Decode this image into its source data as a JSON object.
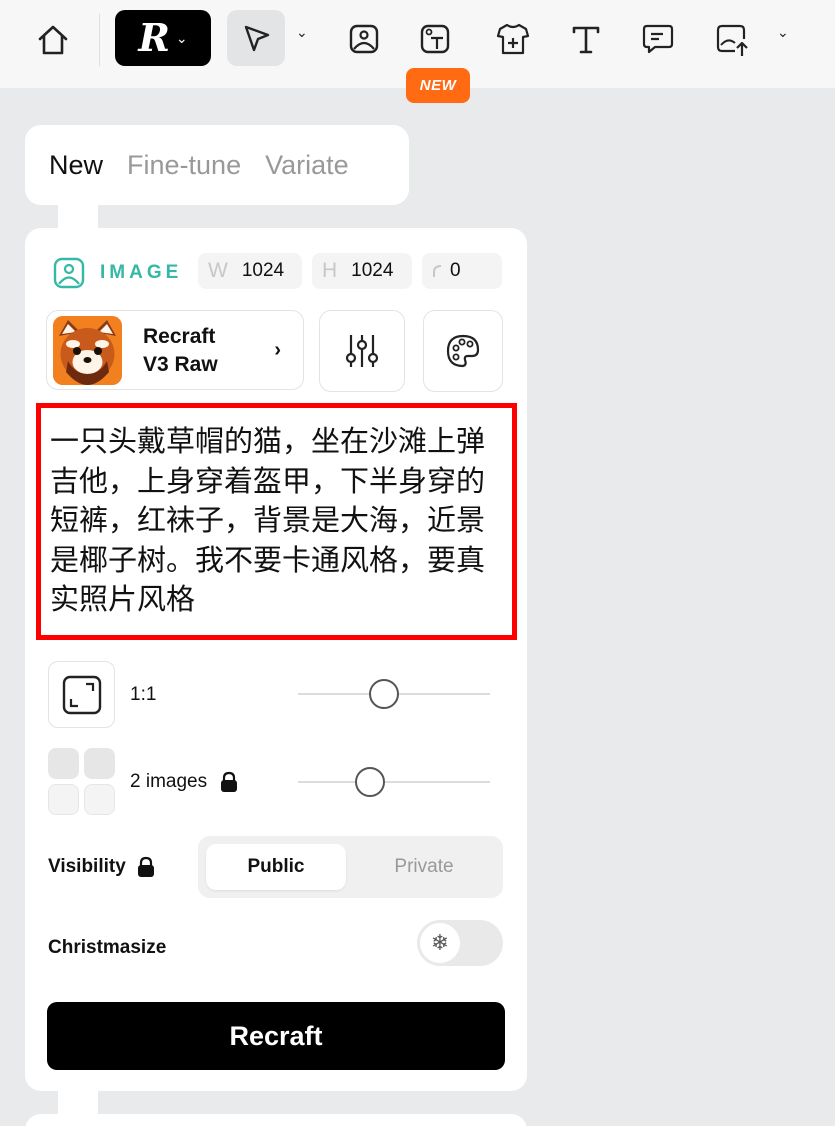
{
  "toolbar": {
    "new_badge": "NEW",
    "logo_letter": "R",
    "items": [
      "home-icon",
      "recraft-logo",
      "select-arrow-icon",
      "image-icon",
      "text-image-icon",
      "mockup-shirt-icon",
      "text-icon",
      "comment-icon",
      "upload-image-icon"
    ]
  },
  "tabs": {
    "new": "New",
    "finetune": "Fine-tune",
    "variate": "Variate"
  },
  "image_settings": {
    "label": "IMAGE",
    "width_label": "W",
    "width": "1024",
    "height_label": "H",
    "height": "1024",
    "corner": "0"
  },
  "model": {
    "line1": "Recraft",
    "line2": "V3 Raw"
  },
  "prompt": {
    "text": "一只头戴草帽的猫，坐在沙滩上弹吉他，上身穿着盔甲，下半身穿的短裤，红袜子，背景是大海，近景是椰子树。我不要卡通风格，要真实照片风格"
  },
  "aspect": {
    "label": "1:1",
    "level": 0.44
  },
  "count": {
    "label": "2 images",
    "level": 0.35
  },
  "visibility": {
    "label": "Visibility",
    "public": "Public",
    "private": "Private"
  },
  "christmasize": {
    "label": "Christmasize"
  },
  "action": {
    "button": "Recraft"
  },
  "colors": {
    "accent_teal": "#35b8a5",
    "badge_orange": "#ff6a13",
    "highlight_red": "#ff0000",
    "primary_black": "#000000"
  }
}
